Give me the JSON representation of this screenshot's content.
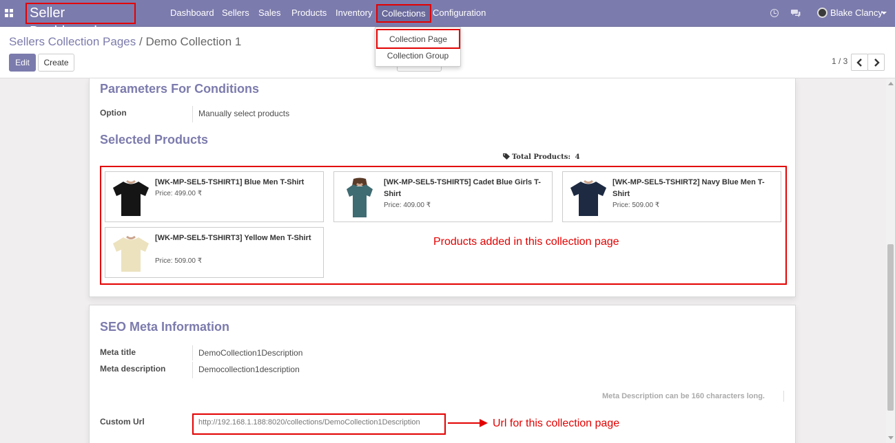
{
  "navbar": {
    "brand": "Seller Dashboard",
    "menu": [
      "Dashboard",
      "Sellers",
      "Sales",
      "Products",
      "Inventory",
      "Collections",
      "Configuration"
    ],
    "active_menu": "Collections",
    "user_name": "Blake Clancy",
    "color": "#7c7bad"
  },
  "dropdown": {
    "items": [
      "Collection Page",
      "Collection Group"
    ]
  },
  "control_panel": {
    "breadcrumb_root": "Sellers Collection Pages",
    "breadcrumb_sep": "/",
    "breadcrumb_current": "Demo Collection 1",
    "edit_label": "Edit",
    "create_label": "Create",
    "pager": "1 / 3"
  },
  "conditions": {
    "title": "Parameters For Conditions",
    "option_label": "Option",
    "option_value": "Manually select products"
  },
  "selected_products": {
    "title": "Selected Products",
    "total_label": "Total Products:",
    "total_value": "4",
    "items": [
      {
        "name": "[WK-MP-SEL5-TSHIRT1] Blue Men T-Shirt",
        "price": "Price: 499.00 ₹",
        "shirt_color": "#151515"
      },
      {
        "name": "[WK-MP-SEL5-TSHIRT5] Cadet Blue Girls T-Shirt",
        "price": "Price: 409.00 ₹",
        "shirt_color": "#3f6b72"
      },
      {
        "name": "[WK-MP-SEL5-TSHIRT2] Navy Blue Men T-Shirt",
        "price": "Price: 509.00 ₹",
        "shirt_color": "#1d2a42"
      },
      {
        "name": "[WK-MP-SEL5-TSHIRT3] Yellow Men T-Shirt",
        "price": "Price: 509.00 ₹",
        "shirt_color": "#ece2be"
      }
    ],
    "annotation": "Products added in this collection page"
  },
  "seo": {
    "title": "SEO Meta Information",
    "meta_title_label": "Meta title",
    "meta_title_value": "DemoCollection1Description",
    "meta_description_label": "Meta description",
    "meta_description_value": "Democollection1description",
    "note": "Meta Description can be 160 characters long.",
    "custom_url_label": "Custom Url",
    "custom_url_value": "http://192.168.1.188:8020/collections/DemoCollection1Description",
    "url_annotation": "Url for this collection page"
  },
  "annotation_color": "#e30000"
}
